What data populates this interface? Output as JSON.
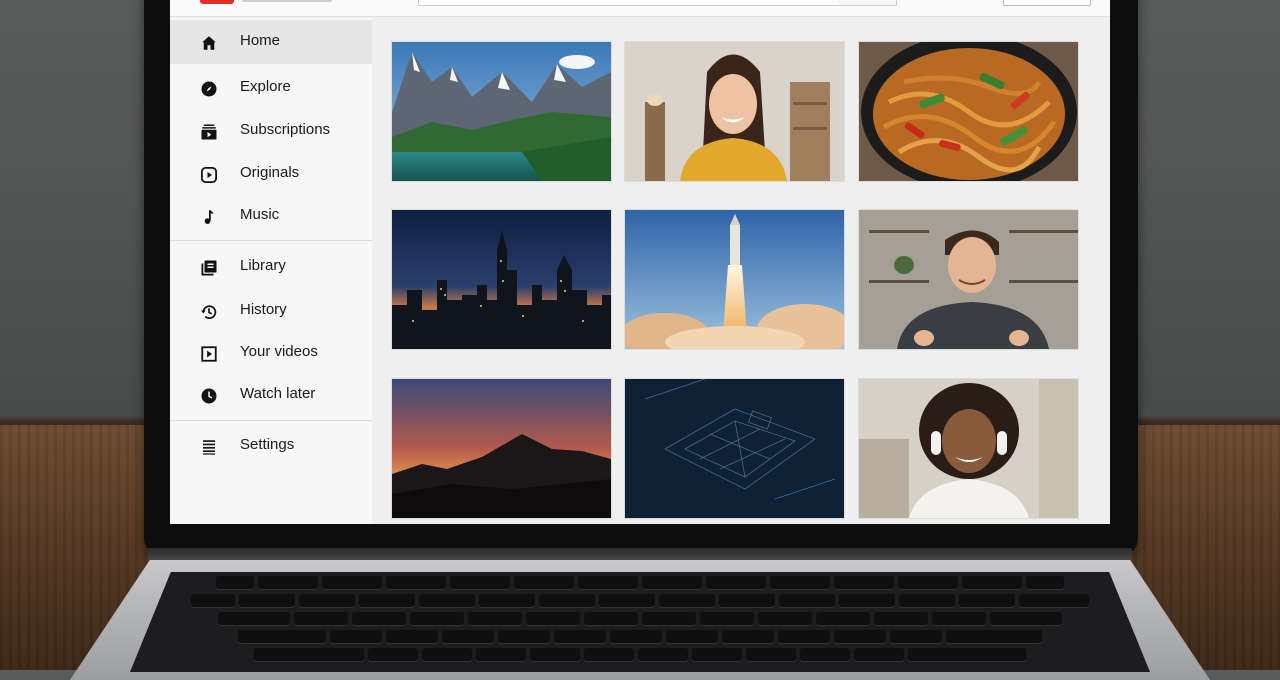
{
  "sidebar": {
    "items": [
      {
        "label": "Home",
        "icon": "home-icon",
        "active": true
      },
      {
        "label": "Explore",
        "icon": "compass-icon",
        "active": false
      },
      {
        "label": "Subscriptions",
        "icon": "subscriptions-icon",
        "active": false
      },
      {
        "label": "Originals",
        "icon": "play-circle-icon",
        "active": false
      },
      {
        "label": "Music",
        "icon": "music-note-icon",
        "active": false
      },
      {
        "label": "Library",
        "icon": "library-icon",
        "active": false
      },
      {
        "label": "History",
        "icon": "history-icon",
        "active": false
      },
      {
        "label": "Your videos",
        "icon": "play-square-icon",
        "active": false
      },
      {
        "label": "Watch later",
        "icon": "clock-icon",
        "active": false
      },
      {
        "label": "Settings",
        "icon": "settings-icon",
        "active": false
      }
    ]
  },
  "videos": [
    {
      "thumbnail": "mountain-lake"
    },
    {
      "thumbnail": "smiling-woman"
    },
    {
      "thumbnail": "noodles-bowl"
    },
    {
      "thumbnail": "city-skyline-night"
    },
    {
      "thumbnail": "rocket-launch"
    },
    {
      "thumbnail": "man-talking"
    },
    {
      "thumbnail": "mountain-sunset"
    },
    {
      "thumbnail": "blueprint"
    },
    {
      "thumbnail": "woman-headphones"
    }
  ],
  "colors": {
    "brand_red": "#e52d27",
    "sidebar_bg": "#f7f7f7",
    "active_bg": "#e6e6e6",
    "content_bg": "#efefef"
  }
}
